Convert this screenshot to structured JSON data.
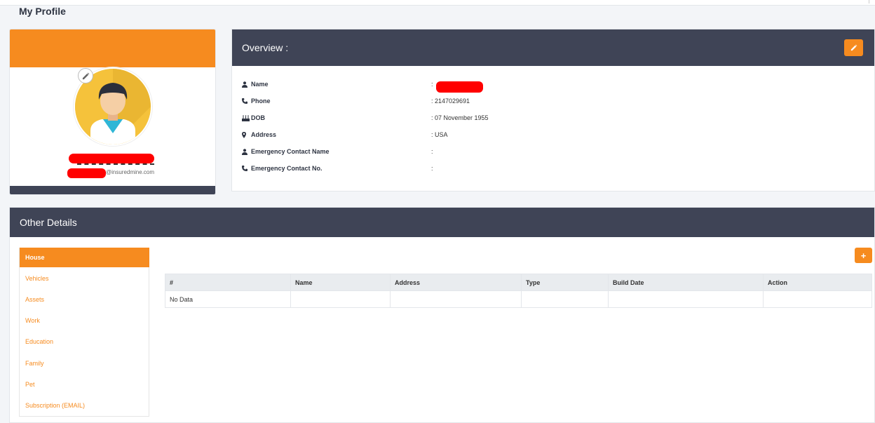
{
  "page": {
    "title": "My Profile"
  },
  "profile": {
    "email_domain": "@insuredmine.com"
  },
  "overview": {
    "title": "Overview :",
    "fields": [
      {
        "label": "Name",
        "icon": "user-icon",
        "value": ":"
      },
      {
        "label": "Phone",
        "icon": "phone-icon",
        "value": ": 2147029691"
      },
      {
        "label": "DOB",
        "icon": "birthday-cake-icon",
        "value": ": 07 November 1955"
      },
      {
        "label": "Address",
        "icon": "map-marker-icon",
        "value": ": USA"
      },
      {
        "label": "Emergency Contact Name",
        "icon": "user-icon",
        "value": ":"
      },
      {
        "label": "Emergency Contact No.",
        "icon": "phone-icon",
        "value": ":"
      }
    ]
  },
  "other": {
    "title": "Other Details",
    "tabs": [
      {
        "label": "House",
        "active": true
      },
      {
        "label": "Vehicles"
      },
      {
        "label": "Assets"
      },
      {
        "label": "Work"
      },
      {
        "label": "Education"
      },
      {
        "label": "Family"
      },
      {
        "label": "Pet"
      },
      {
        "label": "Subscription (EMAIL)"
      }
    ],
    "add_label": "+",
    "table": {
      "headers": [
        "#",
        "Name",
        "Address",
        "Type",
        "Build Date",
        "Action"
      ],
      "empty_text": "No Data"
    }
  },
  "colors": {
    "accent": "#f68b1f",
    "header": "#3f4456",
    "redaction": "#ff0000"
  }
}
